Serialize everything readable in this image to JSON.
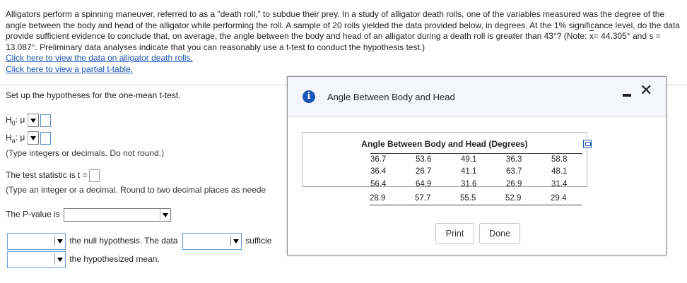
{
  "problem": {
    "text_before_xbar": "Alligators perform a spinning maneuver, referred to as a \"death roll,\" to subdue their prey. In a study of alligator death rolls, one of the variables measured was the degree of the angle between the body and head of the alligator while performing the roll. A sample of 20 rolls yielded the data provided below, in degrees. At the 1% significance level, do the data provide sufficient evidence to conclude that, on average, the angle between the body and head of an alligator during a death roll is greater than 43°? (Note: ",
    "xbar": "x",
    "text_after_xbar": "= 44.305° and s = 13.087°. Preliminary data analyses indicate that you can reasonably use a t-test to conduct the hypothesis test.)",
    "link_data": "Click here to view the data on alligator death rolls.",
    "link_table": "Click here to view a partial t-table."
  },
  "questions": {
    "setup": "Set up the hypotheses for the one-mean t-test.",
    "h0_label": "H",
    "h0_sub": "0",
    "ha_label": "H",
    "ha_sub": "a",
    "mu": ": μ",
    "note1": "(Type integers or decimals. Do not round.)",
    "test_stat": "The test statistic is t =",
    "note2": "(Type an integer or a decimal. Round to two decimal places as neede",
    "pvalue": "The P-value is",
    "null_text": "the null hypothesis. The data",
    "suff_text": "sufficie",
    "hyp_mean_text": "the hypothesized mean."
  },
  "dialog": {
    "title": "Angle Between Body and Head",
    "table_title": "Angle Between Body and Head (Degrees)",
    "rows": [
      [
        "36.7",
        "53.6",
        "49.1",
        "36.3",
        "58.8"
      ],
      [
        "36.4",
        "26.7",
        "41.1",
        "63.7",
        "48.1"
      ],
      [
        "56.4",
        "64.9",
        "31.6",
        "26.9",
        "31.4"
      ],
      [
        "28.9",
        "57.7",
        "55.5",
        "52.9",
        "29.4"
      ]
    ],
    "print_label": "Print",
    "done_label": "Done",
    "close_glyph": "✕"
  },
  "colors": {
    "link": "#1a55b8",
    "info_icon": "#1a55b8"
  }
}
